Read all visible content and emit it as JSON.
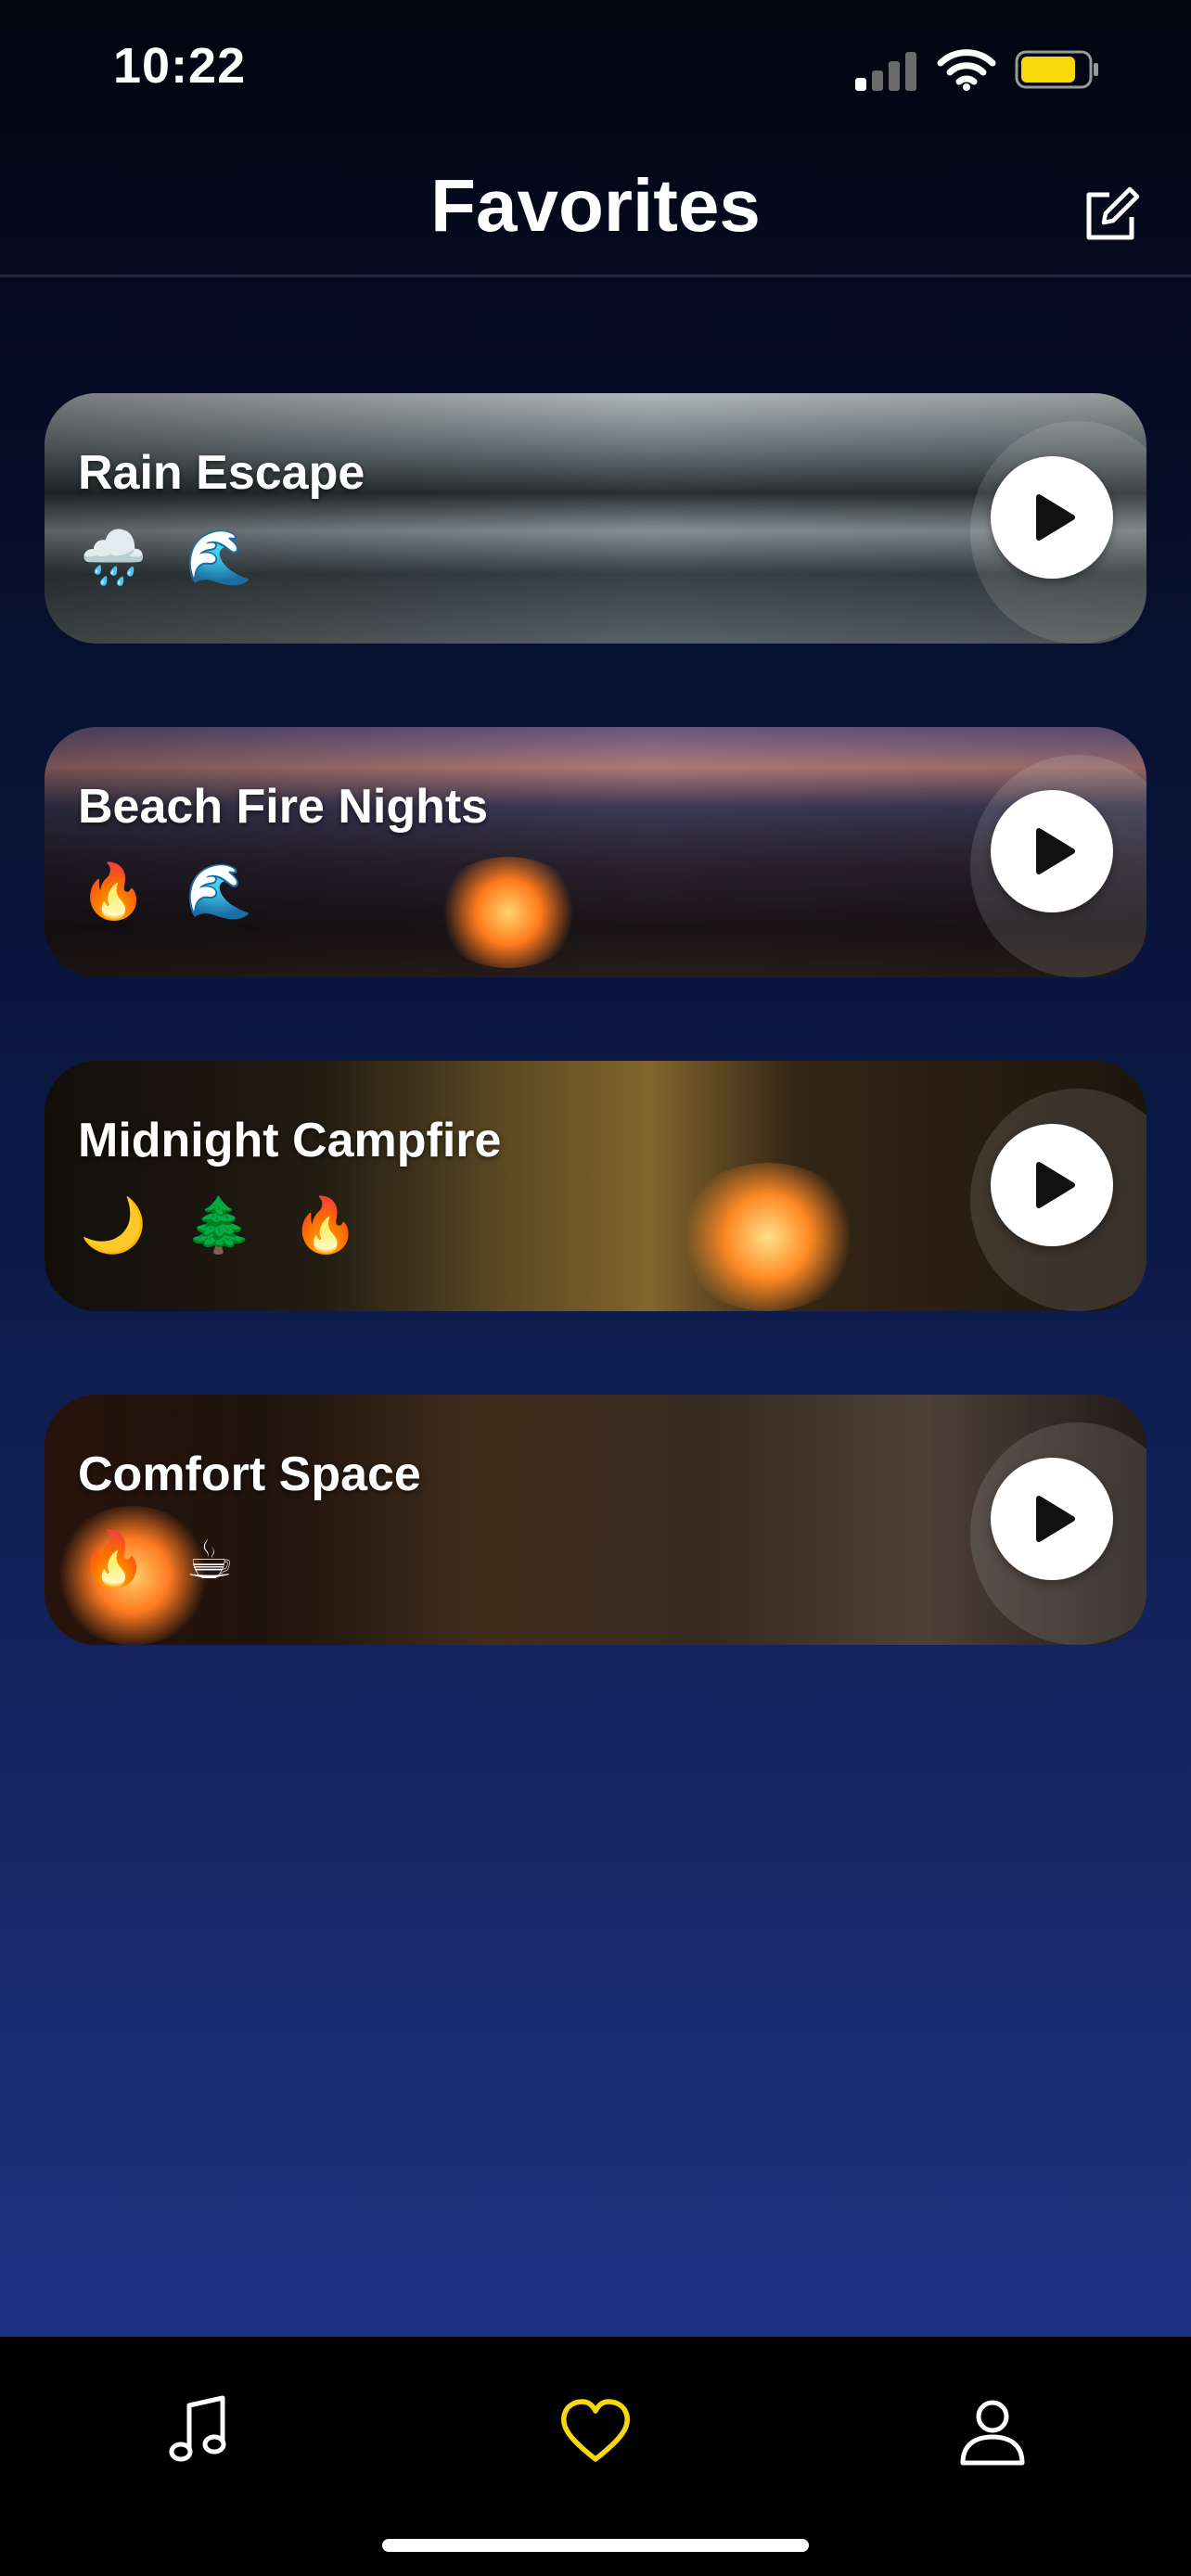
{
  "status_bar": {
    "time": "10:22"
  },
  "header": {
    "title": "Favorites",
    "edit_icon": "edit-icon"
  },
  "favorites": [
    {
      "title": "Rain Escape",
      "emojis": [
        "🌧️",
        "🌊"
      ],
      "play_icon": "play-icon"
    },
    {
      "title": "Beach Fire Nights",
      "emojis": [
        "🔥",
        "🌊"
      ],
      "play_icon": "play-icon"
    },
    {
      "title": "Midnight Campfire",
      "emojis": [
        "🌙",
        "🌲",
        "🔥"
      ],
      "play_icon": "play-icon"
    },
    {
      "title": "Comfort Space",
      "emojis": [
        "🔥",
        "☕"
      ],
      "play_icon": "play-icon"
    }
  ],
  "tab_bar": {
    "tabs": [
      {
        "icon": "music-note-icon",
        "active": false
      },
      {
        "icon": "heart-icon",
        "active": true
      },
      {
        "icon": "person-icon",
        "active": false
      }
    ],
    "active_color": "#f5d90a",
    "inactive_color": "#ffffff"
  },
  "colors": {
    "battery": "#f5d90a",
    "background_top": "#050a20",
    "background_bottom": "#1f3385"
  }
}
